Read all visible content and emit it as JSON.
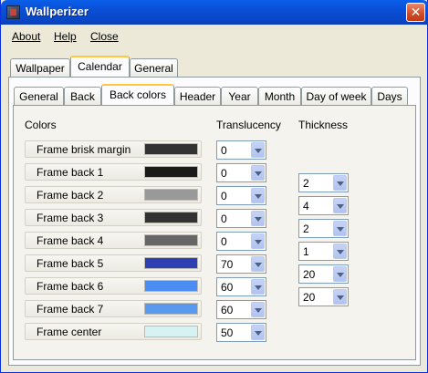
{
  "window": {
    "title": "Wallperizer",
    "close_glyph": "✕"
  },
  "menu": [
    {
      "label": "About"
    },
    {
      "label": "Help"
    },
    {
      "label": "Close"
    }
  ],
  "main_tabs": [
    {
      "label": "Wallpaper",
      "selected": false
    },
    {
      "label": "Calendar",
      "selected": true
    },
    {
      "label": "General",
      "selected": false
    }
  ],
  "sub_tabs": [
    {
      "label": "General",
      "selected": false
    },
    {
      "label": "Back",
      "selected": false
    },
    {
      "label": "Back colors",
      "selected": true
    },
    {
      "label": "Header",
      "selected": false
    },
    {
      "label": "Year",
      "selected": false
    },
    {
      "label": "Month",
      "selected": false
    },
    {
      "label": "Day of week",
      "selected": false
    },
    {
      "label": "Days",
      "selected": false
    }
  ],
  "headers": {
    "colors": "Colors",
    "translucency": "Translucency",
    "thickness": "Thickness"
  },
  "colors": [
    {
      "label": "Frame brisk margin",
      "swatch": "#333333",
      "translucency": "0"
    },
    {
      "label": "Frame back 1",
      "swatch": "#1A1A1A",
      "translucency": "0"
    },
    {
      "label": "Frame back 2",
      "swatch": "#999999",
      "translucency": "0"
    },
    {
      "label": "Frame back 3",
      "swatch": "#333333",
      "translucency": "0"
    },
    {
      "label": "Frame back 4",
      "swatch": "#666666",
      "translucency": "0"
    },
    {
      "label": "Frame back 5",
      "swatch": "#2D3FB2",
      "translucency": "70"
    },
    {
      "label": "Frame back 6",
      "swatch": "#4B8DF0",
      "translucency": "60"
    },
    {
      "label": "Frame back 7",
      "swatch": "#5999EE",
      "translucency": "60"
    },
    {
      "label": "Frame center",
      "swatch": "#D6F2F2",
      "translucency": "50"
    }
  ],
  "thickness": [
    "2",
    "4",
    "2",
    "1",
    "20",
    "20"
  ]
}
